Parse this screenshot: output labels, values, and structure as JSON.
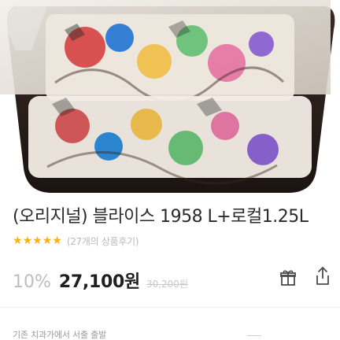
{
  "product": {
    "title": "(오리지널) 블라이스 1958 L+로컬1.25L",
    "rating_stars": 5,
    "reviews_text": "(27개의 상품후기)",
    "discount": "10%",
    "price": "27,100원",
    "original_price": "30,200원"
  },
  "icons": {
    "gift": "gift-icon",
    "share": "share-icon",
    "star": "star-icon"
  },
  "footer": {
    "notice": "기존 치과가에서 서출 출발"
  },
  "colors": {
    "star": "#f3b415",
    "discount": "#bdbdbd",
    "price": "#1f1f1f"
  }
}
